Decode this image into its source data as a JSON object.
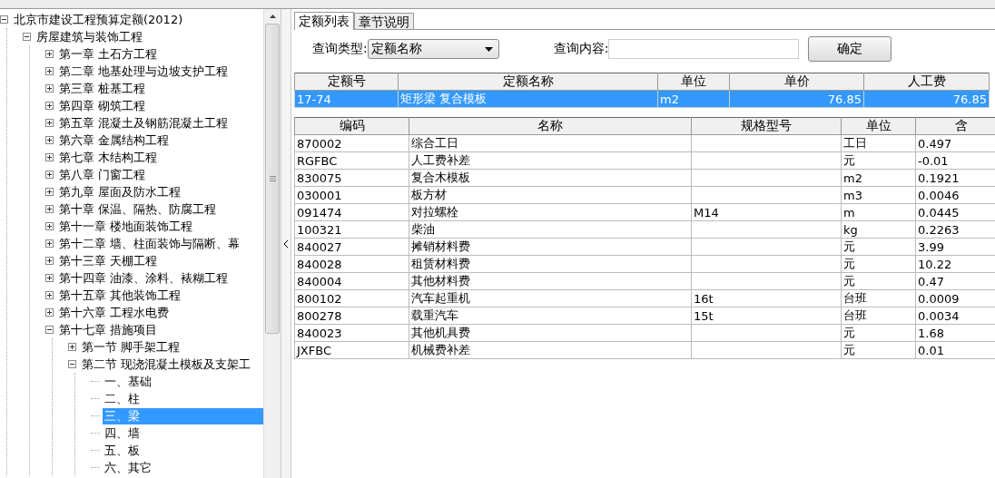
{
  "tree": [
    {
      "label": "北京市建设工程预算定额(2012)",
      "kind": "folder",
      "expanded": true,
      "selected": false,
      "children": [
        {
          "label": "房屋建筑与装饰工程",
          "kind": "folder",
          "expanded": true,
          "selected": false,
          "children": [
            {
              "label": "第一章  土石方工程",
              "kind": "folder",
              "expanded": false,
              "selected": false
            },
            {
              "label": "第二章  地基处理与边坡支护工程",
              "kind": "folder",
              "expanded": false,
              "selected": false
            },
            {
              "label": "第三章  桩基工程",
              "kind": "folder",
              "expanded": false,
              "selected": false
            },
            {
              "label": "第四章  砌筑工程",
              "kind": "folder",
              "expanded": false,
              "selected": false
            },
            {
              "label": "第五章  混凝土及钢筋混凝土工程",
              "kind": "folder",
              "expanded": false,
              "selected": false
            },
            {
              "label": "第六章  金属结构工程",
              "kind": "folder",
              "expanded": false,
              "selected": false
            },
            {
              "label": "第七章  木结构工程",
              "kind": "folder",
              "expanded": false,
              "selected": false
            },
            {
              "label": "第八章  门窗工程",
              "kind": "folder",
              "expanded": false,
              "selected": false
            },
            {
              "label": "第九章  屋面及防水工程",
              "kind": "folder",
              "expanded": false,
              "selected": false
            },
            {
              "label": "第十章  保温、隔热、防腐工程",
              "kind": "folder",
              "expanded": false,
              "selected": false
            },
            {
              "label": "第十一章  楼地面装饰工程",
              "kind": "folder",
              "expanded": false,
              "selected": false
            },
            {
              "label": "第十二章  墙、柱面装饰与隔断、幕",
              "kind": "folder",
              "expanded": false,
              "selected": false
            },
            {
              "label": "第十三章  天棚工程",
              "kind": "folder",
              "expanded": false,
              "selected": false
            },
            {
              "label": "第十四章  油漆、涂料、裱糊工程",
              "kind": "folder",
              "expanded": false,
              "selected": false
            },
            {
              "label": "第十五章  其他装饰工程",
              "kind": "folder",
              "expanded": false,
              "selected": false
            },
            {
              "label": "第十六章  工程水电费",
              "kind": "folder",
              "expanded": false,
              "selected": false
            },
            {
              "label": "第十七章  措施项目",
              "kind": "folder",
              "expanded": true,
              "selected": false,
              "children": [
                {
                  "label": "第一节  脚手架工程",
                  "kind": "folder",
                  "expanded": false,
                  "selected": false
                },
                {
                  "label": "第二节  现浇混凝土模板及支架工",
                  "kind": "folder",
                  "expanded": true,
                  "selected": false,
                  "children": [
                    {
                      "label": "一、基础",
                      "kind": "leaf",
                      "selected": false
                    },
                    {
                      "label": "二、柱",
                      "kind": "leaf",
                      "selected": false
                    },
                    {
                      "label": "三、梁",
                      "kind": "leaf",
                      "selected": true
                    },
                    {
                      "label": "四、墙",
                      "kind": "leaf",
                      "selected": false
                    },
                    {
                      "label": "五、板",
                      "kind": "leaf",
                      "selected": false
                    },
                    {
                      "label": "六、其它",
                      "kind": "leaf",
                      "selected": false
                    }
                  ]
                }
              ]
            }
          ]
        }
      ]
    }
  ],
  "tabs": [
    {
      "label": "定额列表",
      "selected": true
    },
    {
      "label": "章节说明",
      "selected": false
    }
  ],
  "query": {
    "type_label": "查询类型:",
    "type_value": "定额名称",
    "content_label": "查询内容:",
    "confirm": "确定"
  },
  "quota_table": {
    "columns": [
      "定额号",
      "定额名称",
      "单位",
      "单价",
      "人工费"
    ],
    "rows": [
      {
        "cells": [
          "17-74",
          "矩形梁  复合模板",
          "m2",
          "76.85",
          "76.85"
        ],
        "selected": true
      }
    ]
  },
  "resource_table": {
    "columns": [
      "编码",
      "名称",
      "规格型号",
      "单位",
      "含"
    ],
    "rows": [
      [
        "870002",
        "综合工日",
        "",
        "工日",
        "0.497"
      ],
      [
        "RGFBC",
        "人工费补差",
        "",
        "元",
        "-0.01"
      ],
      [
        "830075",
        "复合木模板",
        "",
        "m2",
        "0.1921"
      ],
      [
        "030001",
        "板方材",
        "",
        "m3",
        "0.0046"
      ],
      [
        "091474",
        "对拉螺栓",
        "M14",
        "m",
        "0.0445"
      ],
      [
        "100321",
        "柴油",
        "",
        "kg",
        "0.2263"
      ],
      [
        "840027",
        "摊销材料费",
        "",
        "元",
        "3.99"
      ],
      [
        "840028",
        "租赁材料费",
        "",
        "元",
        "10.22"
      ],
      [
        "840004",
        "其他材料费",
        "",
        "元",
        "0.47"
      ],
      [
        "800102",
        "汽车起重机",
        "16t",
        "台班",
        "0.0009"
      ],
      [
        "800278",
        "载重汽车",
        "15t",
        "台班",
        "0.0034"
      ],
      [
        "840023",
        "其他机具费",
        "",
        "元",
        "1.68"
      ],
      [
        "JXFBC",
        "机械费补差",
        "",
        "元",
        "0.01"
      ]
    ]
  }
}
